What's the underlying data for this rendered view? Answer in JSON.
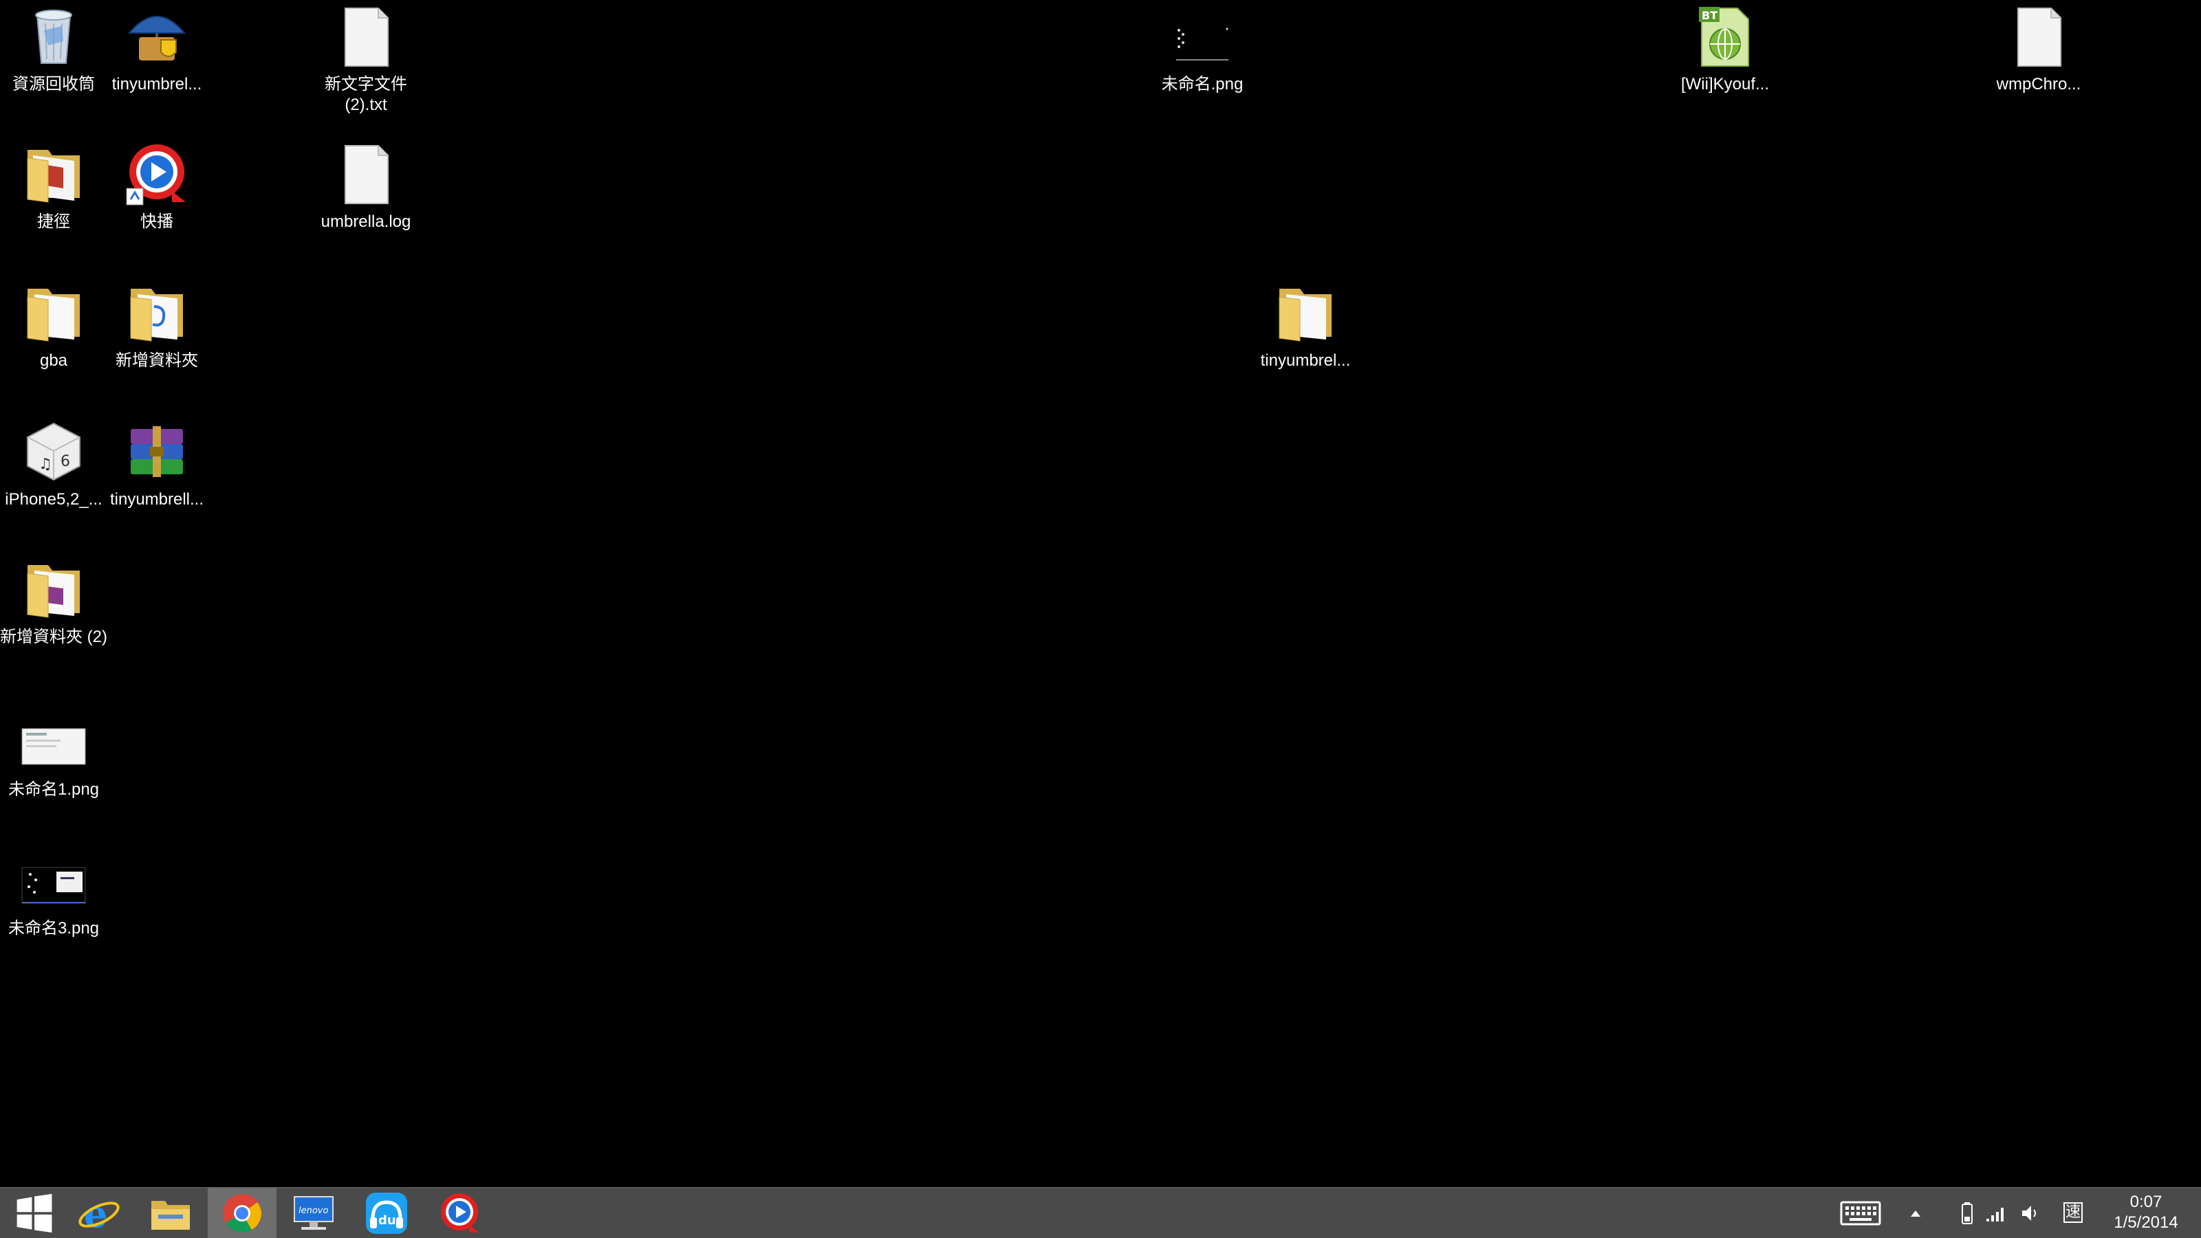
{
  "desktop": {
    "icons": [
      {
        "label": "資源回收筒",
        "icon": "recycle-bin-icon"
      },
      {
        "label": "tinyumbrel...",
        "icon": "tinyumbrella-app-icon"
      },
      {
        "label": "新文字文件 (2).txt",
        "icon": "text-file-icon"
      },
      {
        "label": "未命名.png",
        "icon": "image-thumbnail-icon"
      },
      {
        "label": "[Wii]Kyouf...",
        "icon": "bittorrent-file-icon"
      },
      {
        "label": "wmpChro...",
        "icon": "blank-file-icon"
      },
      {
        "label": "捷徑",
        "icon": "folder-icon"
      },
      {
        "label": "快播",
        "icon": "qvod-player-icon"
      },
      {
        "label": "umbrella.log",
        "icon": "log-file-icon"
      },
      {
        "label": "gba",
        "icon": "folder-icon"
      },
      {
        "label": "新增資料夾",
        "icon": "folder-icon"
      },
      {
        "label": "tinyumbrel...",
        "icon": "folder-icon"
      },
      {
        "label": "iPhone5,2_...",
        "icon": "ipsw-firmware-icon"
      },
      {
        "label": "tinyumbrell...",
        "icon": "winrar-archive-icon"
      },
      {
        "label": "新增資料夾 (2)",
        "icon": "folder-icon"
      },
      {
        "label": "未命名1.png",
        "icon": "image-thumbnail-icon"
      },
      {
        "label": "未命名3.png",
        "icon": "image-thumbnail-icon"
      }
    ]
  },
  "taskbar": {
    "pinned": [
      {
        "name": "start-icon"
      },
      {
        "name": "internet-explorer-icon"
      },
      {
        "name": "file-explorer-icon"
      },
      {
        "name": "chrome-icon"
      },
      {
        "name": "lenovo-icon"
      },
      {
        "name": "baidu-music-icon"
      },
      {
        "name": "qvod-player-icon"
      }
    ],
    "tray": {
      "ime_label": "速",
      "time": "0:07",
      "date": "1/5/2014"
    }
  },
  "colors": {
    "desktop_background": "#000000",
    "taskbar_background": "#4a4a4a",
    "folder_yellow": "#f0cf6a",
    "accent_blue": "#1e90ff"
  }
}
